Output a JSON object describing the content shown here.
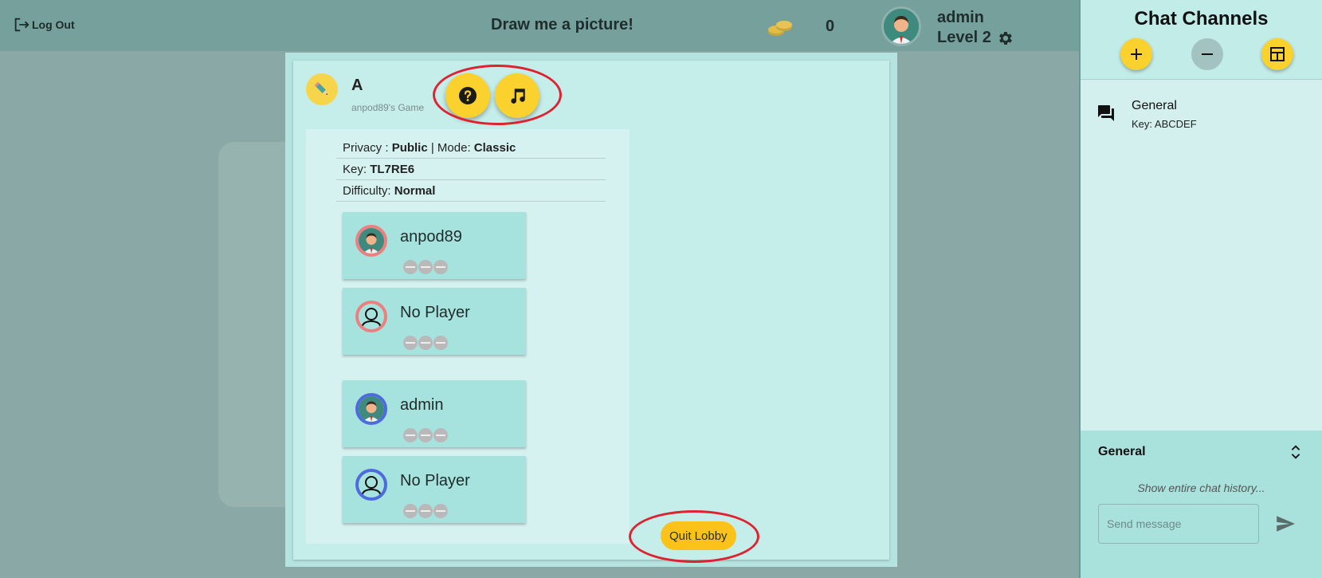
{
  "header": {
    "logout_label": "Log Out",
    "app_title": "Draw me a picture!",
    "coin_count": "0",
    "user_name": "admin",
    "user_level": "Level 2"
  },
  "lobby": {
    "game_name": "A",
    "game_owner": "anpod89's Game",
    "privacy_label": "Privacy : ",
    "privacy_value": "Public",
    "mode_label": " | Mode: ",
    "mode_value": "Classic",
    "key_label": "Key: ",
    "key_value": "TL7RE6",
    "difficulty_label": "Difficulty: ",
    "difficulty_value": "Normal",
    "players": [
      {
        "name": "anpod89",
        "team": "red",
        "avatar": "person-avatar"
      },
      {
        "name": "No Player",
        "team": "red",
        "avatar": "empty-avatar"
      },
      {
        "name": "admin",
        "team": "blue",
        "avatar": "person-avatar"
      },
      {
        "name": "No Player",
        "team": "blue",
        "avatar": "empty-avatar"
      }
    ],
    "quit_label": "Quit Lobby"
  },
  "chat": {
    "title": "Chat Channels",
    "channels": [
      {
        "name": "General",
        "key": "Key: ABCDEF"
      }
    ],
    "active_channel": "General",
    "history_link": "Show entire chat history...",
    "message_placeholder": "Send message"
  },
  "colors": {
    "accent_yellow": "#fbd12e",
    "quit_yellow": "#fbc21a",
    "annotation_red": "#e0212f",
    "team_red": "#ee7f7f",
    "team_blue": "#4e6bde"
  }
}
